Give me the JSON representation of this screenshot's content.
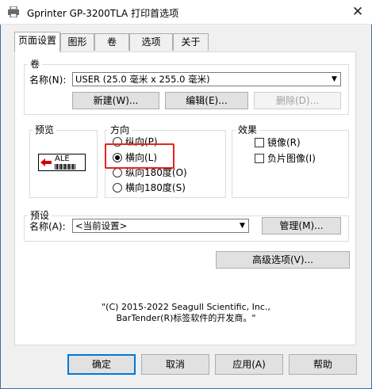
{
  "window": {
    "title": "Gprinter GP-3200TLA 打印首选项",
    "close_symbol": "✕"
  },
  "tabs": [
    {
      "label": "页面设置",
      "active": true
    },
    {
      "label": "图形",
      "active": false
    },
    {
      "label": "卷",
      "active": false
    },
    {
      "label": "选项",
      "active": false
    },
    {
      "label": "关于",
      "active": false
    }
  ],
  "stock": {
    "group_label": "卷",
    "name_label": "名称(N):",
    "name_value": "USER (25.0 毫米 x 255.0 毫米)",
    "new_button": "新建(W)...",
    "edit_button": "编辑(E)...",
    "delete_button": "删除(D)..."
  },
  "preview": {
    "group_label": "预览",
    "sample_text": "ALE"
  },
  "orientation": {
    "group_label": "方向",
    "options": [
      {
        "label": "纵向(P)",
        "checked": false
      },
      {
        "label": "横向(L)",
        "checked": true
      },
      {
        "label": "纵向180度(O)",
        "checked": false
      },
      {
        "label": "横向180度(S)",
        "checked": false
      }
    ]
  },
  "effects": {
    "group_label": "效果",
    "mirror_label": "镜像(R)",
    "negative_label": "负片图像(I)"
  },
  "presets": {
    "group_label": "预设",
    "name_label": "名称(A):",
    "name_value": "<当前设置>",
    "manage_button": "管理(M)..."
  },
  "advanced_button": "高级选项(V)...",
  "copyright": {
    "line1": "\"(C) 2015-2022 Seagull Scientific, Inc.,",
    "line2": "BarTender(R)标签软件的开发商。\""
  },
  "buttons": {
    "ok": "确定",
    "cancel": "取消",
    "apply": "应用(A)",
    "help": "帮助"
  },
  "colors": {
    "accent": "#0078d7",
    "highlight": "#e8231e"
  }
}
